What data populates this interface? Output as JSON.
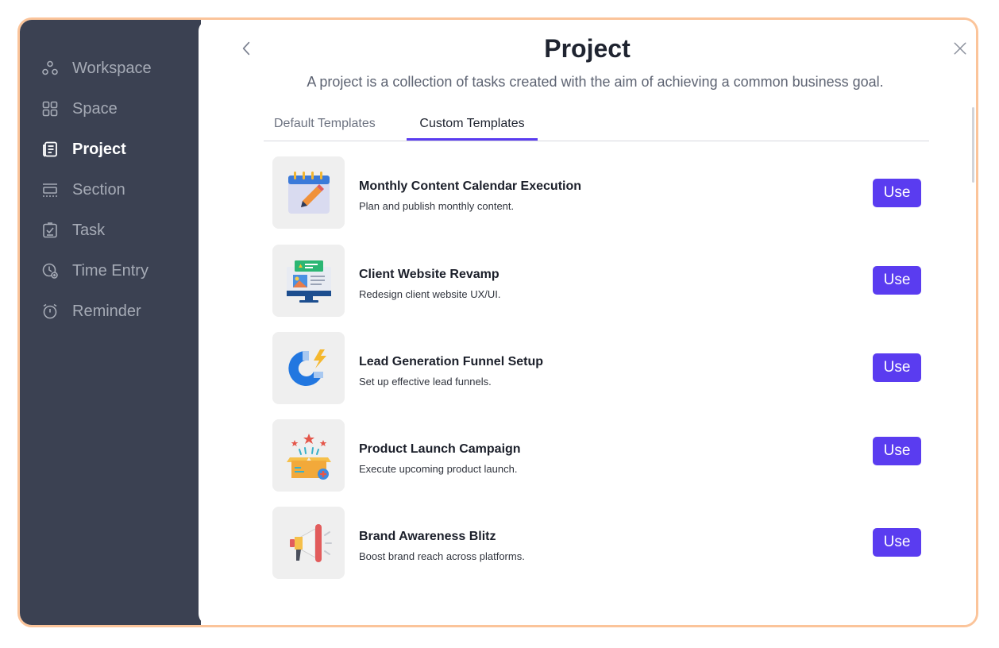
{
  "sidebar": {
    "items": [
      {
        "label": "Workspace",
        "icon": "workspace-icon"
      },
      {
        "label": "Space",
        "icon": "space-icon"
      },
      {
        "label": "Project",
        "icon": "project-icon"
      },
      {
        "label": "Section",
        "icon": "section-icon"
      },
      {
        "label": "Task",
        "icon": "task-icon"
      },
      {
        "label": "Time Entry",
        "icon": "time-entry-icon"
      },
      {
        "label": "Reminder",
        "icon": "reminder-icon"
      }
    ],
    "active": "Project"
  },
  "header": {
    "title": "Project",
    "subtitle": "A project is a collection of tasks created with the aim of achieving a common business goal."
  },
  "tabs": [
    {
      "label": "Default Templates"
    },
    {
      "label": "Custom Templates"
    }
  ],
  "active_tab": "Custom Templates",
  "templates": [
    {
      "title": "Monthly Content Calendar Execution",
      "description": "Plan and publish monthly content.",
      "button": "Use",
      "icon": "calendar-pencil-icon"
    },
    {
      "title": "Client Website Revamp",
      "description": "Redesign client website UX/UI.",
      "button": "Use",
      "icon": "monitor-website-icon"
    },
    {
      "title": "Lead Generation Funnel Setup",
      "description": "Set up effective lead funnels.",
      "button": "Use",
      "icon": "magnet-icon"
    },
    {
      "title": "Product Launch Campaign",
      "description": "Execute upcoming product launch.",
      "button": "Use",
      "icon": "product-box-icon"
    },
    {
      "title": "Brand Awareness Blitz",
      "description": "Boost brand reach across platforms.",
      "button": "Use",
      "icon": "megaphone-icon"
    }
  ],
  "colors": {
    "accent": "#5a3cf0",
    "sidebar_bg": "#3b4152",
    "frame_border": "#fbc49a"
  }
}
